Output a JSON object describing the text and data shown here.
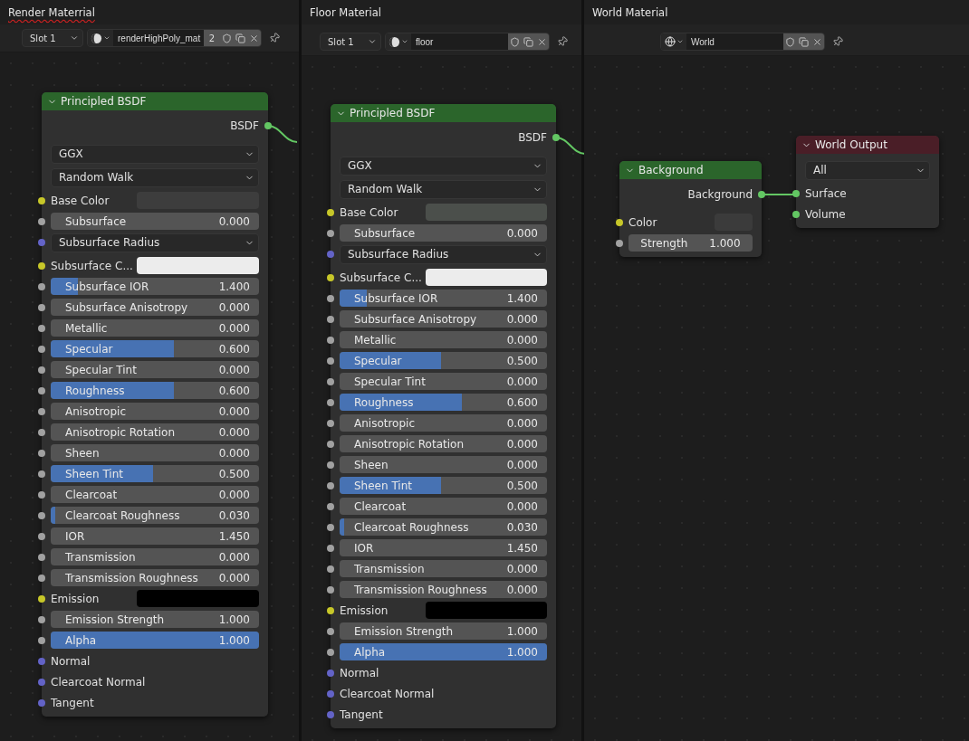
{
  "panels": [
    {
      "title": "Render Materrial",
      "misspelled": true,
      "toolbar": {
        "world": false,
        "slot": "Slot 1",
        "name": "renderHighPoly_mat",
        "users": "2"
      },
      "nodes": [
        {
          "title": "Principled BSDF",
          "kind": "shader",
          "rows": [
            {
              "kind": "output",
              "label": "BSDF",
              "socket": {
                "color": "#63c763"
              },
              "linked": true
            },
            {
              "kind": "select",
              "value": "GGX"
            },
            {
              "kind": "select",
              "value": "Random Walk"
            },
            {
              "kind": "color",
              "label": "Base Color",
              "socket": {
                "color": "#c7c729"
              },
              "color": "#3d3d3d"
            },
            {
              "kind": "value",
              "label": "Subsurface",
              "value": "0.000",
              "socket": {
                "color": "#a1a1a1"
              },
              "level": 0
            },
            {
              "kind": "select",
              "value": "Subsurface Radius",
              "socket": {
                "color": "#6363c7"
              }
            },
            {
              "kind": "color",
              "label": "Subsurface C...",
              "socket": {
                "color": "#c7c729"
              },
              "color": "#ececec"
            },
            {
              "kind": "value",
              "label": "Subsurface IOR",
              "value": "1.400",
              "socket": {
                "color": "#a1a1a1"
              },
              "level": 0.13
            },
            {
              "kind": "value",
              "label": "Subsurface Anisotropy",
              "value": "0.000",
              "socket": {
                "color": "#a1a1a1"
              },
              "level": 0
            },
            {
              "kind": "value",
              "label": "Metallic",
              "value": "0.000",
              "socket": {
                "color": "#a1a1a1"
              },
              "level": 0
            },
            {
              "kind": "value",
              "label": "Specular",
              "value": "0.600",
              "socket": {
                "color": "#a1a1a1"
              },
              "level": 0.59
            },
            {
              "kind": "value",
              "label": "Specular Tint",
              "value": "0.000",
              "socket": {
                "color": "#a1a1a1"
              },
              "level": 0
            },
            {
              "kind": "value",
              "label": "Roughness",
              "value": "0.600",
              "socket": {
                "color": "#a1a1a1"
              },
              "level": 0.59
            },
            {
              "kind": "value",
              "label": "Anisotropic",
              "value": "0.000",
              "socket": {
                "color": "#a1a1a1"
              },
              "level": 0
            },
            {
              "kind": "value",
              "label": "Anisotropic Rotation",
              "value": "0.000",
              "socket": {
                "color": "#a1a1a1"
              },
              "level": 0
            },
            {
              "kind": "value",
              "label": "Sheen",
              "value": "0.000",
              "socket": {
                "color": "#a1a1a1"
              },
              "level": 0
            },
            {
              "kind": "value",
              "label": "Sheen Tint",
              "value": "0.500",
              "socket": {
                "color": "#a1a1a1"
              },
              "level": 0.49
            },
            {
              "kind": "value",
              "label": "Clearcoat",
              "value": "0.000",
              "socket": {
                "color": "#a1a1a1"
              },
              "level": 0
            },
            {
              "kind": "value",
              "label": "Clearcoat Roughness",
              "value": "0.030",
              "socket": {
                "color": "#a1a1a1"
              },
              "level": 0.02
            },
            {
              "kind": "value",
              "label": "IOR",
              "value": "1.450",
              "socket": {
                "color": "#a1a1a1"
              },
              "level": 0
            },
            {
              "kind": "value",
              "label": "Transmission",
              "value": "0.000",
              "socket": {
                "color": "#a1a1a1"
              },
              "level": 0
            },
            {
              "kind": "value",
              "label": "Transmission Roughness",
              "value": "0.000",
              "socket": {
                "color": "#a1a1a1"
              },
              "level": 0
            },
            {
              "kind": "color",
              "label": "Emission",
              "socket": {
                "color": "#c7c729"
              },
              "color": "#000000"
            },
            {
              "kind": "value",
              "label": "Emission Strength",
              "value": "1.000",
              "socket": {
                "color": "#a1a1a1"
              },
              "level": 0
            },
            {
              "kind": "value",
              "label": "Alpha",
              "value": "1.000",
              "socket": {
                "color": "#a1a1a1"
              },
              "level": 1
            },
            {
              "kind": "input",
              "label": "Normal",
              "socket": {
                "color": "#6363c7"
              }
            },
            {
              "kind": "input",
              "label": "Clearcoat Normal",
              "socket": {
                "color": "#6363c7"
              }
            },
            {
              "kind": "input",
              "label": "Tangent",
              "socket": {
                "color": "#6363c7"
              }
            }
          ]
        }
      ]
    },
    {
      "title": "Floor Material",
      "misspelled": false,
      "toolbar": {
        "world": false,
        "slot": "Slot 1",
        "name": "floor"
      },
      "nodes": [
        {
          "title": "Principled BSDF",
          "kind": "shader",
          "rows": [
            {
              "kind": "output",
              "label": "BSDF",
              "socket": {
                "color": "#63c763"
              },
              "linked": true
            },
            {
              "kind": "select",
              "value": "GGX"
            },
            {
              "kind": "select",
              "value": "Random Walk"
            },
            {
              "kind": "color",
              "label": "Base Color",
              "socket": {
                "color": "#c7c729"
              },
              "color": "#4b4f4b"
            },
            {
              "kind": "value",
              "label": "Subsurface",
              "value": "0.000",
              "socket": {
                "color": "#a1a1a1"
              },
              "level": 0
            },
            {
              "kind": "select",
              "value": "Subsurface Radius",
              "socket": {
                "color": "#6363c7"
              }
            },
            {
              "kind": "color",
              "label": "Subsurface C...",
              "socket": {
                "color": "#c7c729"
              },
              "color": "#ececec"
            },
            {
              "kind": "value",
              "label": "Subsurface IOR",
              "value": "1.400",
              "socket": {
                "color": "#a1a1a1"
              },
              "level": 0.13
            },
            {
              "kind": "value",
              "label": "Subsurface Anisotropy",
              "value": "0.000",
              "socket": {
                "color": "#a1a1a1"
              },
              "level": 0
            },
            {
              "kind": "value",
              "label": "Metallic",
              "value": "0.000",
              "socket": {
                "color": "#a1a1a1"
              },
              "level": 0
            },
            {
              "kind": "value",
              "label": "Specular",
              "value": "0.500",
              "socket": {
                "color": "#a1a1a1"
              },
              "level": 0.49
            },
            {
              "kind": "value",
              "label": "Specular Tint",
              "value": "0.000",
              "socket": {
                "color": "#a1a1a1"
              },
              "level": 0
            },
            {
              "kind": "value",
              "label": "Roughness",
              "value": "0.600",
              "socket": {
                "color": "#a1a1a1"
              },
              "level": 0.59
            },
            {
              "kind": "value",
              "label": "Anisotropic",
              "value": "0.000",
              "socket": {
                "color": "#a1a1a1"
              },
              "level": 0
            },
            {
              "kind": "value",
              "label": "Anisotropic Rotation",
              "value": "0.000",
              "socket": {
                "color": "#a1a1a1"
              },
              "level": 0
            },
            {
              "kind": "value",
              "label": "Sheen",
              "value": "0.000",
              "socket": {
                "color": "#a1a1a1"
              },
              "level": 0
            },
            {
              "kind": "value",
              "label": "Sheen Tint",
              "value": "0.500",
              "socket": {
                "color": "#a1a1a1"
              },
              "level": 0.49
            },
            {
              "kind": "value",
              "label": "Clearcoat",
              "value": "0.000",
              "socket": {
                "color": "#a1a1a1"
              },
              "level": 0
            },
            {
              "kind": "value",
              "label": "Clearcoat Roughness",
              "value": "0.030",
              "socket": {
                "color": "#a1a1a1"
              },
              "level": 0.02
            },
            {
              "kind": "value",
              "label": "IOR",
              "value": "1.450",
              "socket": {
                "color": "#a1a1a1"
              },
              "level": 0
            },
            {
              "kind": "value",
              "label": "Transmission",
              "value": "0.000",
              "socket": {
                "color": "#a1a1a1"
              },
              "level": 0
            },
            {
              "kind": "value",
              "label": "Transmission Roughness",
              "value": "0.000",
              "socket": {
                "color": "#a1a1a1"
              },
              "level": 0
            },
            {
              "kind": "color",
              "label": "Emission",
              "socket": {
                "color": "#c7c729"
              },
              "color": "#000000"
            },
            {
              "kind": "value",
              "label": "Emission Strength",
              "value": "1.000",
              "socket": {
                "color": "#a1a1a1"
              },
              "level": 0
            },
            {
              "kind": "value",
              "label": "Alpha",
              "value": "1.000",
              "socket": {
                "color": "#a1a1a1"
              },
              "level": 1
            },
            {
              "kind": "input",
              "label": "Normal",
              "socket": {
                "color": "#6363c7"
              }
            },
            {
              "kind": "input",
              "label": "Clearcoat Normal",
              "socket": {
                "color": "#6363c7"
              }
            },
            {
              "kind": "input",
              "label": "Tangent",
              "socket": {
                "color": "#6363c7"
              }
            }
          ]
        }
      ]
    },
    {
      "title": "World Material",
      "misspelled": false,
      "toolbar": {
        "world": true,
        "name": "World"
      },
      "nodes": [
        {
          "title": "World Output",
          "kind": "output",
          "rows": [
            {
              "kind": "select",
              "value": "All"
            },
            {
              "kind": "input",
              "label": "Surface",
              "socket": {
                "color": "#63c763"
              }
            },
            {
              "kind": "input",
              "label": "Volume",
              "socket": {
                "color": "#63c763"
              }
            }
          ]
        },
        {
          "title": "Background",
          "kind": "shader",
          "rows": [
            {
              "kind": "output",
              "label": "Background",
              "socket": {
                "color": "#63c763"
              },
              "linked": true
            },
            {
              "kind": "color",
              "label": "Color",
              "socket": {
                "color": "#c7c729"
              },
              "color": "#3b3b3b"
            },
            {
              "kind": "number",
              "label": "Strength",
              "value": "1.000",
              "socket": {
                "color": "#a1a1a1"
              }
            }
          ]
        }
      ]
    }
  ]
}
